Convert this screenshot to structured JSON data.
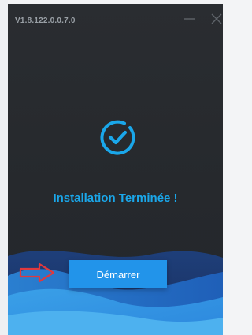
{
  "window": {
    "version": "V1.8.122.0.0.7.0"
  },
  "main": {
    "status_icon": "check-circle-icon",
    "status_text": "Installation Terminée !",
    "start_button_label": "Démarrer"
  },
  "annotation": {
    "icon": "pointer-arrow-icon",
    "color": "#e0393e"
  },
  "colors": {
    "accent": "#1aa7ea",
    "button": "#2294ea",
    "background": "#26292d"
  }
}
